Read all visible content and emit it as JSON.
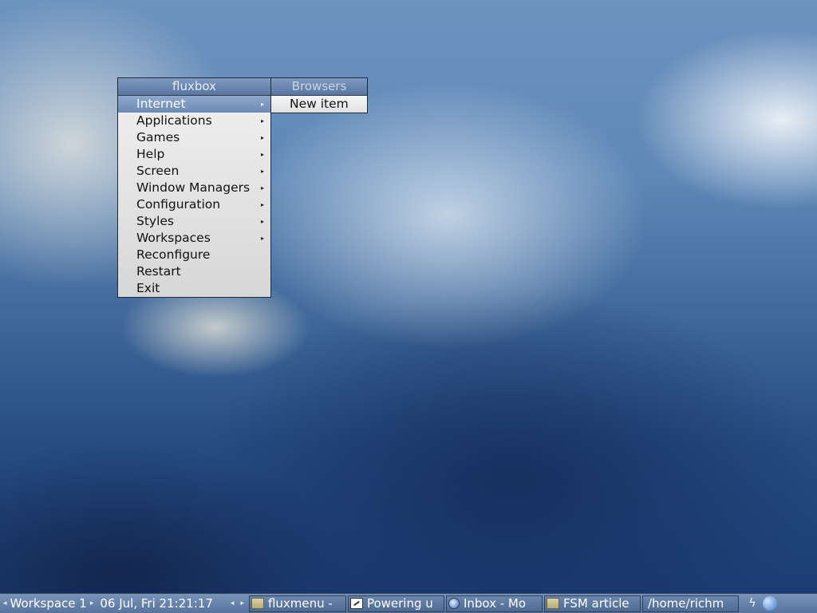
{
  "main_menu": {
    "title": "fluxbox",
    "items": [
      {
        "label": "Internet",
        "submenu": true,
        "active": true
      },
      {
        "label": "Applications",
        "submenu": true
      },
      {
        "label": "Games",
        "submenu": true
      },
      {
        "label": "Help",
        "submenu": true
      },
      {
        "label": "Screen",
        "submenu": true
      },
      {
        "label": "Window Managers",
        "submenu": true
      },
      {
        "label": "Configuration",
        "submenu": true
      },
      {
        "label": "Styles",
        "submenu": true
      },
      {
        "label": "Workspaces",
        "submenu": true
      },
      {
        "label": "Reconfigure",
        "submenu": false
      },
      {
        "label": "Restart",
        "submenu": false
      },
      {
        "label": "Exit",
        "submenu": false
      }
    ],
    "arrow_glyph": "▸"
  },
  "sub_menu": {
    "title": "Browsers",
    "items": [
      {
        "label": "New item"
      }
    ]
  },
  "taskbar": {
    "prev_glyph": "◂",
    "next_glyph": "▸",
    "workspace": "Workspace 1",
    "clock": "06 Jul, Fri 21:21:17",
    "tasks": [
      {
        "label": "fluxmenu -",
        "icon": "folder-icon"
      },
      {
        "label": "Powering u",
        "icon": "text-editor-icon"
      },
      {
        "label": "Inbox - Mo",
        "icon": "mail-client-icon"
      },
      {
        "label": "FSM article",
        "icon": "folder-icon"
      },
      {
        "label": "/home/richm",
        "icon": ""
      }
    ],
    "tray": [
      {
        "icon": "lightning-icon",
        "glyph": "ϟ"
      },
      {
        "icon": "swirl-app-icon",
        "glyph": ""
      }
    ]
  },
  "colors": {
    "menu_title_bg": "#6a86ae",
    "menu_active_bg": "#7b97c0",
    "taskbar_bg": "#6883aa"
  }
}
